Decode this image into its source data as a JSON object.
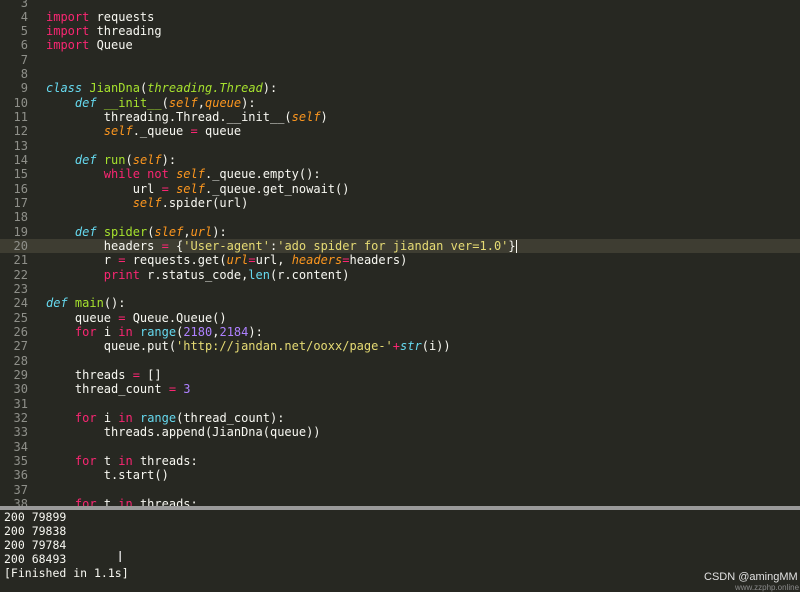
{
  "editor": {
    "active_line": "20",
    "lines": [
      {
        "n": "3",
        "tokens": []
      },
      {
        "n": "4",
        "tokens": [
          {
            "c": "kw",
            "t": "import"
          },
          {
            "c": "",
            "t": " requests"
          }
        ]
      },
      {
        "n": "5",
        "tokens": [
          {
            "c": "kw",
            "t": "import"
          },
          {
            "c": "",
            "t": " threading"
          }
        ]
      },
      {
        "n": "6",
        "tokens": [
          {
            "c": "kw",
            "t": "import"
          },
          {
            "c": "",
            "t": " Queue"
          }
        ]
      },
      {
        "n": "7",
        "tokens": []
      },
      {
        "n": "8",
        "tokens": []
      },
      {
        "n": "9",
        "tokens": [
          {
            "c": "df",
            "t": "class"
          },
          {
            "c": "",
            "t": " "
          },
          {
            "c": "fn",
            "t": "JianDna"
          },
          {
            "c": "",
            "t": "("
          },
          {
            "c": "it",
            "t": "threading.Thread"
          },
          {
            "c": "",
            "t": "):"
          }
        ]
      },
      {
        "n": "10",
        "tokens": [
          {
            "c": "",
            "t": "    "
          },
          {
            "c": "df",
            "t": "def"
          },
          {
            "c": "",
            "t": " "
          },
          {
            "c": "fn",
            "t": "__init__"
          },
          {
            "c": "",
            "t": "("
          },
          {
            "c": "sf",
            "t": "self"
          },
          {
            "c": "",
            "t": ","
          },
          {
            "c": "sf",
            "t": "queue"
          },
          {
            "c": "",
            "t": "):"
          }
        ]
      },
      {
        "n": "11",
        "tokens": [
          {
            "c": "",
            "t": "        threading.Thread.__init__("
          },
          {
            "c": "sf",
            "t": "self"
          },
          {
            "c": "",
            "t": ")"
          }
        ]
      },
      {
        "n": "12",
        "tokens": [
          {
            "c": "",
            "t": "        "
          },
          {
            "c": "sf",
            "t": "self"
          },
          {
            "c": "",
            "t": "._queue "
          },
          {
            "c": "kw",
            "t": "="
          },
          {
            "c": "",
            "t": " queue"
          }
        ]
      },
      {
        "n": "13",
        "tokens": []
      },
      {
        "n": "14",
        "tokens": [
          {
            "c": "",
            "t": "    "
          },
          {
            "c": "df",
            "t": "def"
          },
          {
            "c": "",
            "t": " "
          },
          {
            "c": "fn",
            "t": "run"
          },
          {
            "c": "",
            "t": "("
          },
          {
            "c": "sf",
            "t": "self"
          },
          {
            "c": "",
            "t": "):"
          }
        ]
      },
      {
        "n": "15",
        "tokens": [
          {
            "c": "",
            "t": "        "
          },
          {
            "c": "kw",
            "t": "while not"
          },
          {
            "c": "",
            "t": " "
          },
          {
            "c": "sf",
            "t": "self"
          },
          {
            "c": "",
            "t": "._queue.empty():"
          }
        ]
      },
      {
        "n": "16",
        "tokens": [
          {
            "c": "",
            "t": "            url "
          },
          {
            "c": "kw",
            "t": "="
          },
          {
            "c": "",
            "t": " "
          },
          {
            "c": "sf",
            "t": "self"
          },
          {
            "c": "",
            "t": "._queue.get_nowait()"
          }
        ]
      },
      {
        "n": "17",
        "tokens": [
          {
            "c": "",
            "t": "            "
          },
          {
            "c": "sf",
            "t": "self"
          },
          {
            "c": "",
            "t": ".spider(url)"
          }
        ]
      },
      {
        "n": "18",
        "tokens": []
      },
      {
        "n": "19",
        "tokens": [
          {
            "c": "",
            "t": "    "
          },
          {
            "c": "df",
            "t": "def"
          },
          {
            "c": "",
            "t": " "
          },
          {
            "c": "fn",
            "t": "spider"
          },
          {
            "c": "",
            "t": "("
          },
          {
            "c": "sf",
            "t": "slef"
          },
          {
            "c": "",
            "t": ","
          },
          {
            "c": "sf",
            "t": "url"
          },
          {
            "c": "",
            "t": "):"
          }
        ]
      },
      {
        "n": "20",
        "tokens": [
          {
            "c": "",
            "t": "        headers "
          },
          {
            "c": "kw",
            "t": "="
          },
          {
            "c": "",
            "t": " {"
          },
          {
            "c": "st",
            "t": "'User-agent'"
          },
          {
            "c": "",
            "t": ":"
          },
          {
            "c": "st",
            "t": "'ado spider for jiandan ver=1.0'"
          },
          {
            "c": "",
            "t": "}"
          },
          {
            "c": "cursor",
            "t": ""
          }
        ]
      },
      {
        "n": "21",
        "tokens": [
          {
            "c": "",
            "t": "        r "
          },
          {
            "c": "kw",
            "t": "="
          },
          {
            "c": "",
            "t": " requests.get("
          },
          {
            "c": "sf",
            "t": "url"
          },
          {
            "c": "kw",
            "t": "="
          },
          {
            "c": "",
            "t": "url, "
          },
          {
            "c": "sf",
            "t": "headers"
          },
          {
            "c": "kw",
            "t": "="
          },
          {
            "c": "",
            "t": "headers)"
          }
        ]
      },
      {
        "n": "22",
        "tokens": [
          {
            "c": "",
            "t": "        "
          },
          {
            "c": "kw",
            "t": "print"
          },
          {
            "c": "",
            "t": " r.status_code,"
          },
          {
            "c": "bi",
            "t": "len"
          },
          {
            "c": "",
            "t": "(r.content)"
          }
        ]
      },
      {
        "n": "23",
        "tokens": []
      },
      {
        "n": "24",
        "tokens": [
          {
            "c": "df",
            "t": "def"
          },
          {
            "c": "",
            "t": " "
          },
          {
            "c": "fn",
            "t": "main"
          },
          {
            "c": "",
            "t": "():"
          }
        ]
      },
      {
        "n": "25",
        "tokens": [
          {
            "c": "",
            "t": "    queue "
          },
          {
            "c": "kw",
            "t": "="
          },
          {
            "c": "",
            "t": " Queue.Queue()"
          }
        ]
      },
      {
        "n": "26",
        "tokens": [
          {
            "c": "",
            "t": "    "
          },
          {
            "c": "kw",
            "t": "for"
          },
          {
            "c": "",
            "t": " i "
          },
          {
            "c": "kw",
            "t": "in"
          },
          {
            "c": "",
            "t": " "
          },
          {
            "c": "bi",
            "t": "range"
          },
          {
            "c": "",
            "t": "("
          },
          {
            "c": "nm",
            "t": "2180"
          },
          {
            "c": "",
            "t": ","
          },
          {
            "c": "nm",
            "t": "2184"
          },
          {
            "c": "",
            "t": "):"
          }
        ]
      },
      {
        "n": "27",
        "tokens": [
          {
            "c": "",
            "t": "        queue.put("
          },
          {
            "c": "st",
            "t": "'http://jandan.net/ooxx/page-'"
          },
          {
            "c": "kw",
            "t": "+"
          },
          {
            "c": "df",
            "t": "str"
          },
          {
            "c": "",
            "t": "(i))"
          }
        ]
      },
      {
        "n": "28",
        "tokens": []
      },
      {
        "n": "29",
        "tokens": [
          {
            "c": "",
            "t": "    threads "
          },
          {
            "c": "kw",
            "t": "="
          },
          {
            "c": "",
            "t": " []"
          }
        ]
      },
      {
        "n": "30",
        "tokens": [
          {
            "c": "",
            "t": "    thread_count "
          },
          {
            "c": "kw",
            "t": "="
          },
          {
            "c": "",
            "t": " "
          },
          {
            "c": "nm",
            "t": "3"
          }
        ]
      },
      {
        "n": "31",
        "tokens": []
      },
      {
        "n": "32",
        "tokens": [
          {
            "c": "",
            "t": "    "
          },
          {
            "c": "kw",
            "t": "for"
          },
          {
            "c": "",
            "t": " i "
          },
          {
            "c": "kw",
            "t": "in"
          },
          {
            "c": "",
            "t": " "
          },
          {
            "c": "bi",
            "t": "range"
          },
          {
            "c": "",
            "t": "(thread_count):"
          }
        ]
      },
      {
        "n": "33",
        "tokens": [
          {
            "c": "",
            "t": "        threads.append(JianDna(queue))"
          }
        ]
      },
      {
        "n": "34",
        "tokens": []
      },
      {
        "n": "35",
        "tokens": [
          {
            "c": "",
            "t": "    "
          },
          {
            "c": "kw",
            "t": "for"
          },
          {
            "c": "",
            "t": " t "
          },
          {
            "c": "kw",
            "t": "in"
          },
          {
            "c": "",
            "t": " threads:"
          }
        ]
      },
      {
        "n": "36",
        "tokens": [
          {
            "c": "",
            "t": "        t.start()"
          }
        ]
      },
      {
        "n": "37",
        "tokens": []
      },
      {
        "n": "38",
        "tokens": [
          {
            "c": "",
            "t": "    "
          },
          {
            "c": "kw",
            "t": "for"
          },
          {
            "c": "",
            "t": " t "
          },
          {
            "c": "kw",
            "t": "in"
          },
          {
            "c": "",
            "t": " threads:"
          }
        ]
      }
    ]
  },
  "console": {
    "lines": [
      "200 79899",
      "200 79838",
      "200 79784",
      "200 68493",
      "[Finished in 1.1s]"
    ]
  },
  "watermark": {
    "text": "CSDN @amingMM",
    "subtext": "www.zzphp.online"
  }
}
